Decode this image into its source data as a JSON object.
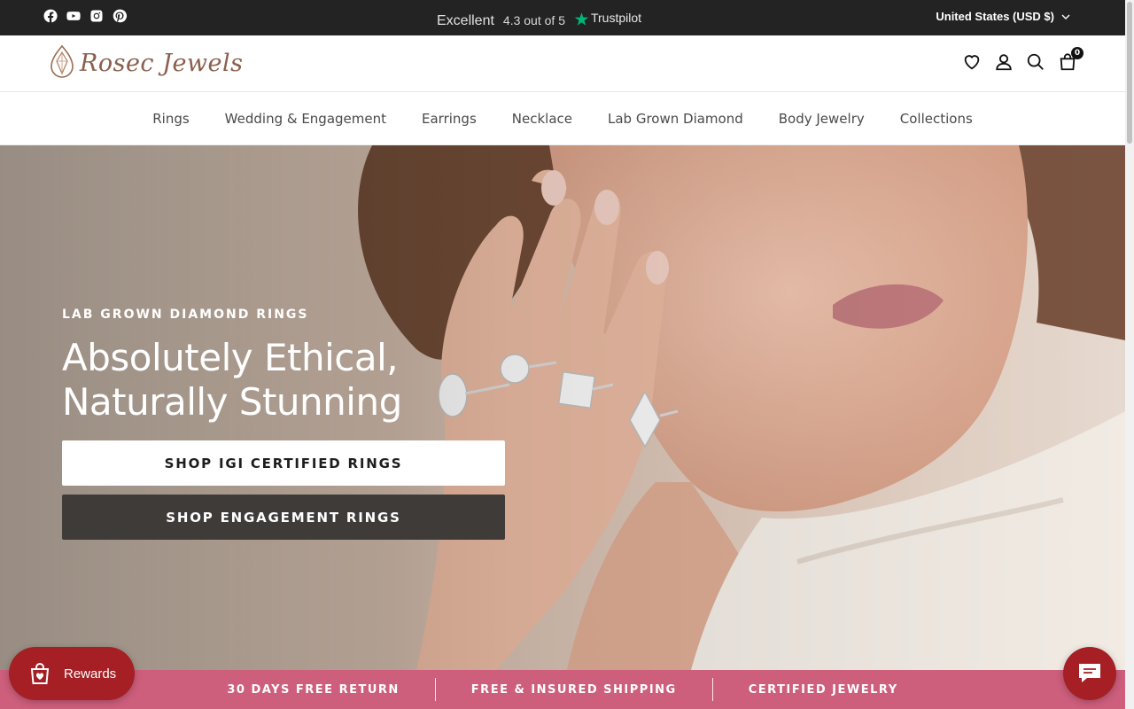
{
  "topbar": {
    "socials": [
      "facebook-icon",
      "youtube-icon",
      "instagram-icon",
      "pinterest-icon"
    ],
    "trustpilot": {
      "excellent": "Excellent",
      "rating": "4.3 out of 5",
      "brand": "Trustpilot",
      "star_color": "#00b67a"
    },
    "currency": "United States (USD $)"
  },
  "header": {
    "logo_text": "Rosec Jewels",
    "cart_count": "0",
    "icons": [
      "heart-icon",
      "user-icon",
      "search-icon",
      "cart-icon"
    ]
  },
  "nav": {
    "items": [
      "Rings",
      "Wedding & Engagement",
      "Earrings",
      "Necklace",
      "Lab Grown Diamond",
      "Body Jewelry",
      "Collections"
    ]
  },
  "hero": {
    "eyebrow": "LAB GROWN DIAMOND RINGS",
    "headline_line1": "Absolutely Ethical,",
    "headline_line2": "Naturally Stunning",
    "button_primary": "SHOP IGI CERTIFIED RINGS",
    "button_secondary": "SHOP ENGAGEMENT RINGS"
  },
  "infobar": {
    "items": [
      "30 DAYS FREE RETURN",
      "FREE & INSURED SHIPPING",
      "CERTIFIED JEWELRY"
    ],
    "color": "#cd5e7c"
  },
  "widgets": {
    "rewards_label": "Rewards",
    "accent_color": "#a51f24"
  }
}
